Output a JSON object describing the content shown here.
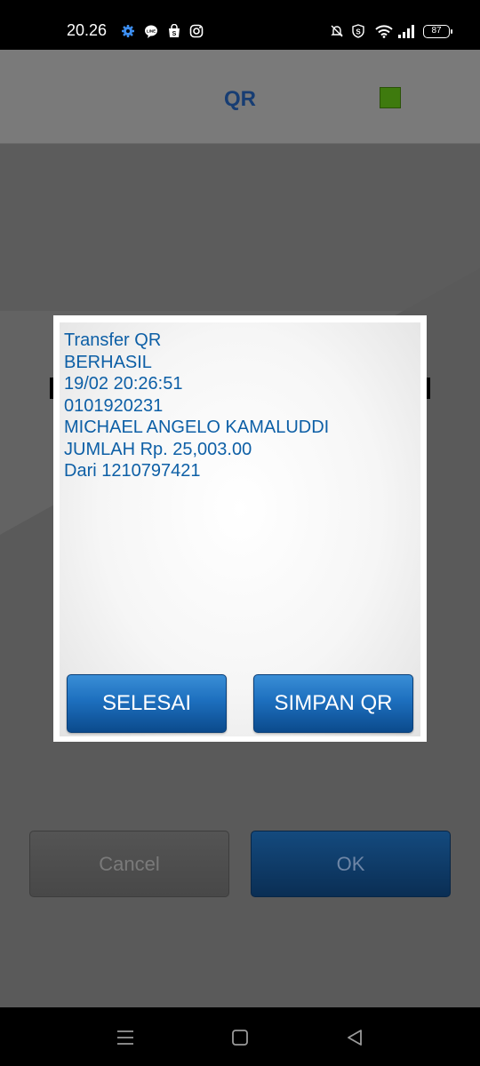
{
  "status_bar": {
    "time": "20.26",
    "battery": "87",
    "left_icons": [
      "gear-icon",
      "line-app-icon",
      "shopping-bag-icon",
      "instagram-icon"
    ],
    "right_icons": [
      "bell-muted-icon",
      "shield-s-icon",
      "wifi-icon",
      "signal-icon",
      "battery-icon"
    ]
  },
  "header": {
    "title": "QR",
    "title_color": "#173d73",
    "indicator_color": "#3e7a0e"
  },
  "dialog": {
    "lines": [
      "Transfer QR",
      "BERHASIL",
      "19/02 20:26:51",
      "0101920231",
      "MICHAEL ANGELO KAMALUDDI",
      "JUMLAH Rp. 25,003.00",
      "Dari 1210797421"
    ],
    "text_color": "#0d5fa6",
    "buttons": {
      "selesai": "SELESAI",
      "simpan": "SIMPAN QR"
    }
  },
  "background_buttons": {
    "cancel": "Cancel",
    "ok": "OK"
  },
  "nav_bar": {
    "icons": [
      "menu-icon",
      "home-icon",
      "back-icon"
    ]
  }
}
